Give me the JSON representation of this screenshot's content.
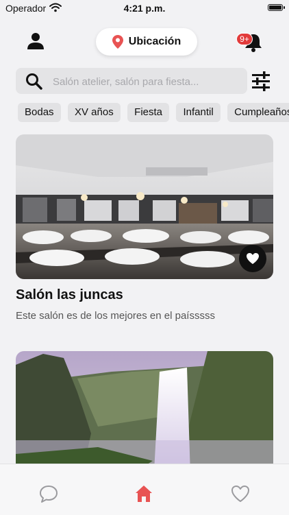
{
  "status_bar": {
    "carrier": "Operador",
    "time": "4:21 p.m."
  },
  "header": {
    "location_label": "Ubicación",
    "notification_badge": "9+"
  },
  "search": {
    "placeholder": "Salón atelier, salón para fiesta..."
  },
  "categories": [
    "Bodas",
    "XV años",
    "Fiesta",
    "Infantil",
    "Cumpleaños"
  ],
  "venues": [
    {
      "title": "Salón las juncas",
      "description": "Este salón es de los mejores en el paísssss"
    },
    {
      "title": "",
      "description": ""
    }
  ],
  "tabs": [
    {
      "icon": "chat-icon",
      "active": false
    },
    {
      "icon": "home-icon",
      "active": true
    },
    {
      "icon": "heart-icon",
      "active": false
    }
  ],
  "colors": {
    "accent": "#e85353",
    "badge": "#e23b3b",
    "dark": "#111111"
  }
}
